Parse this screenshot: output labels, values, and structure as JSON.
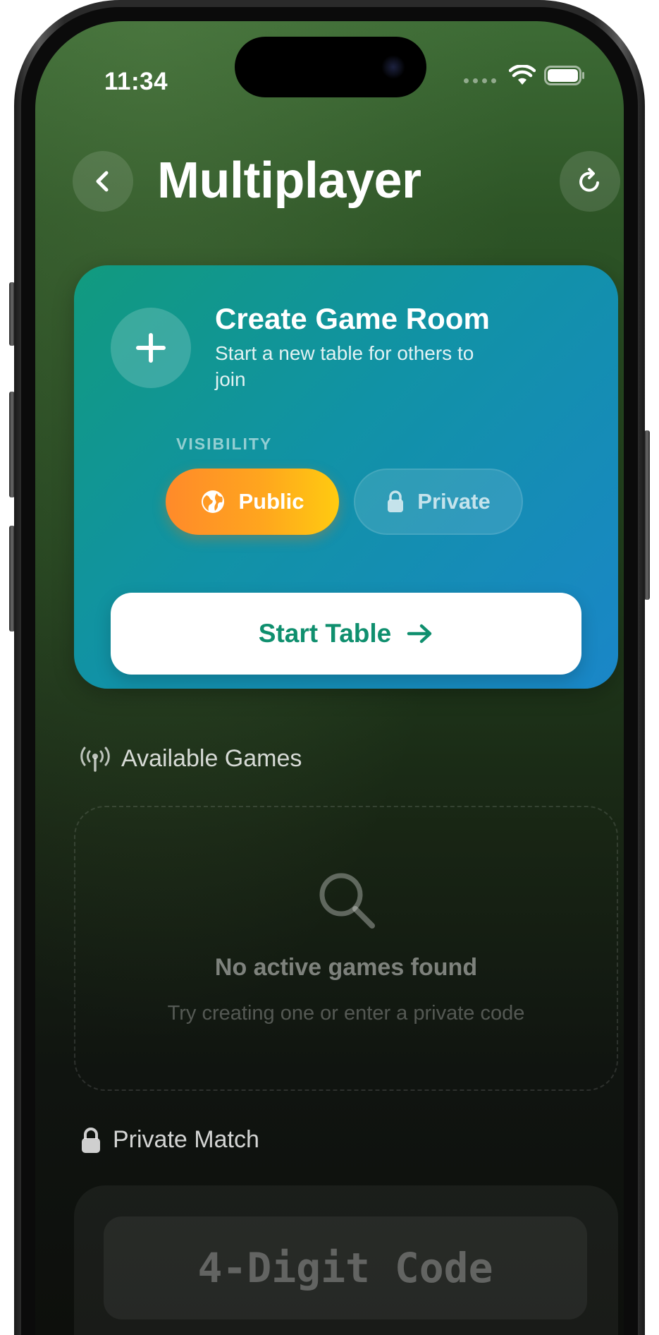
{
  "status_bar": {
    "time": "11:34"
  },
  "header": {
    "title": "Multiplayer",
    "back_icon": "chevron-left-icon",
    "refresh_icon": "refresh-icon"
  },
  "create_room": {
    "title": "Create Game Room",
    "subtitle": "Start a new table for others to join",
    "visibility_label": "VISIBILITY",
    "options": [
      {
        "label": "Public",
        "icon": "globe-icon",
        "selected": true
      },
      {
        "label": "Private",
        "icon": "lock-icon",
        "selected": false
      }
    ],
    "start_label": "Start Table",
    "colors": {
      "card_start": "#119a7e",
      "card_end": "#1a86c8",
      "public_start": "#ff8a2a",
      "public_end": "#ffcb10",
      "start_text": "#0f8f6e"
    }
  },
  "available_games": {
    "heading": "Available Games",
    "empty_title": "No active games found",
    "empty_subtitle": "Try creating one or enter a private code"
  },
  "private_match": {
    "heading": "Private Match",
    "code_placeholder": "4-Digit Code",
    "code_value": ""
  }
}
